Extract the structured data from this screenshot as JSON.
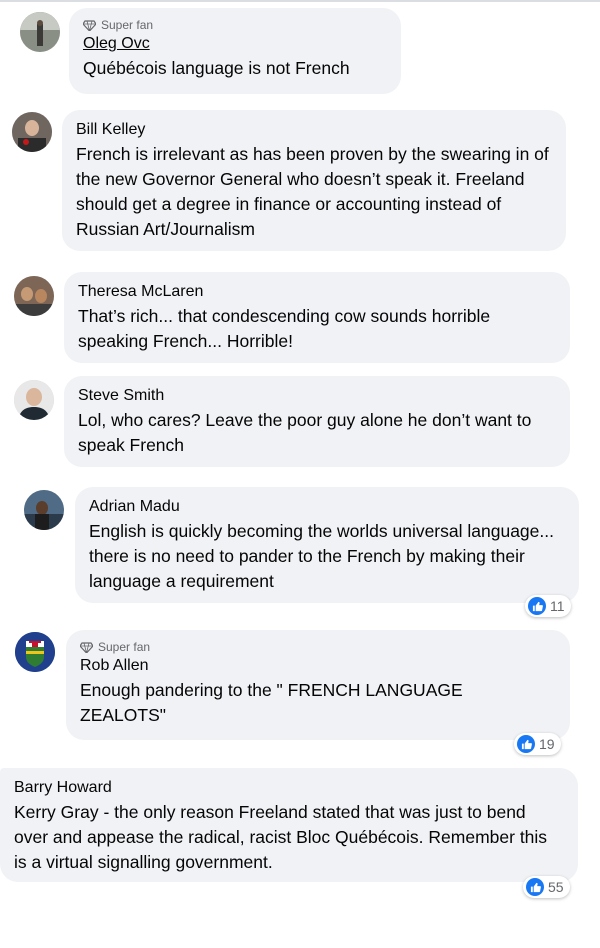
{
  "comments": [
    {
      "badge": "Super fan",
      "name": "Oleg Ovc",
      "text": "Québécois language is not French"
    },
    {
      "name": "Bill Kelley",
      "text": "French is irrelevant as has been proven by the swearing in of the new Governor General who doesn’t speak it. Freeland should get a degree in finance or accounting instead of Russian Art/Journalism"
    },
    {
      "name": "Theresa McLaren",
      "text": "That’s rich... that condescending cow sounds horrible speaking French... Horrible!"
    },
    {
      "name": "Steve Smith",
      "text": "Lol, who cares? Leave the poor guy alone he don’t want to speak French"
    },
    {
      "name": "Adrian Madu",
      "text": "English is quickly becoming the worlds universal language... there is no need to pander to the French by making their language a requirement",
      "reactions": "11"
    },
    {
      "badge": "Super fan",
      "name": "Rob Allen",
      "text": "Enough pandering to the \" FRENCH LANGUAGE ZEALOTS\"",
      "reactions": "19"
    },
    {
      "name": "Barry Howard",
      "text": "Kerry Gray - the only reason Freeland stated that was just to bend over and appease the radical, racist Bloc Québécois. Remember this is a virtual signalling government.",
      "reactions": "55"
    }
  ],
  "icons": {
    "badge": "diamond-icon",
    "reaction": "like-icon"
  },
  "colors": {
    "bubble": "#f0f2f5",
    "like": "#1877f2"
  }
}
